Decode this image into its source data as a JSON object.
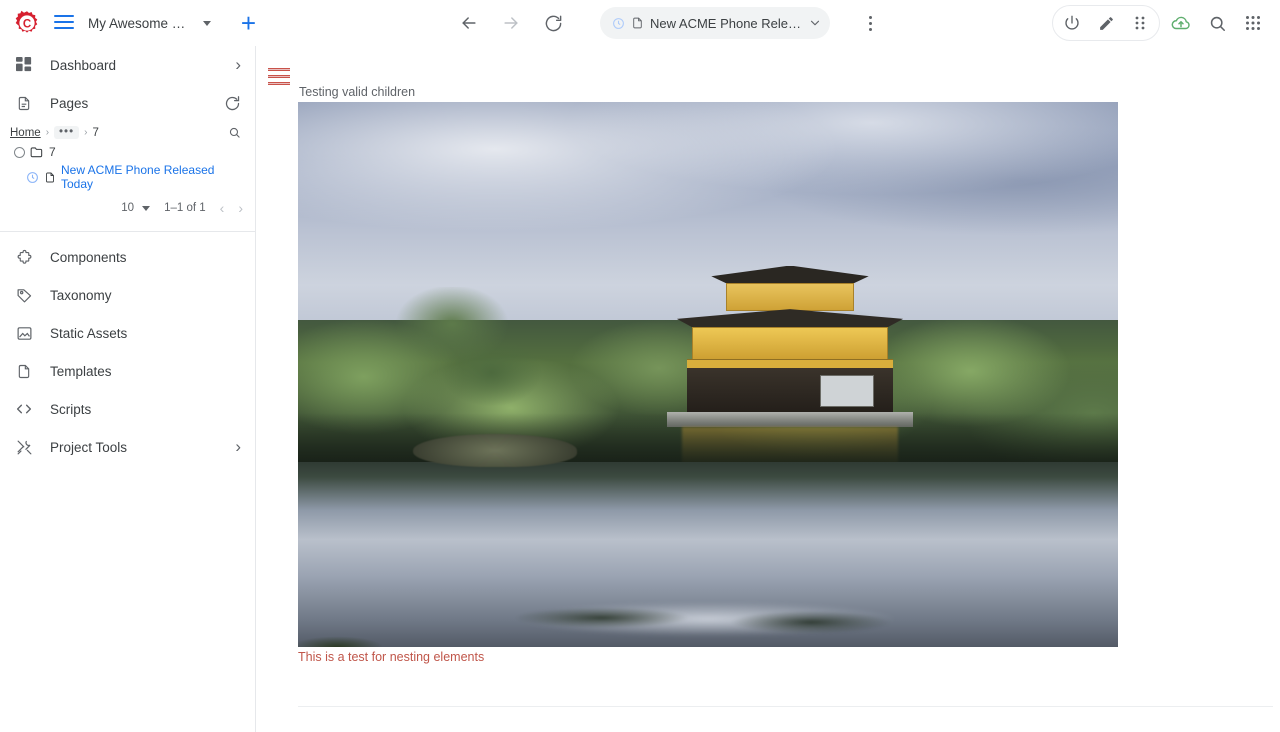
{
  "browser": {
    "back_label": "Back",
    "forward_label": "Forward",
    "reload_label": "Reload",
    "tab_title": "New ACME Phone Released ...",
    "menu_label": "More options",
    "dropdown_label": "Open dropdown"
  },
  "app": {
    "project_name": "My Awesome E...",
    "logo_letter": "C",
    "add_label": "+"
  },
  "toolbar_right": {
    "items": [
      {
        "name": "power-icon",
        "label": "Power"
      },
      {
        "name": "edit-pencil-icon",
        "label": "Edit"
      },
      {
        "name": "drag-dots-icon",
        "label": "Drag"
      },
      {
        "name": "cloud-upload-icon",
        "label": "Publish",
        "color": "#34a853"
      },
      {
        "name": "search-icon",
        "label": "Search"
      },
      {
        "name": "apps-grid-icon",
        "label": "Apps"
      }
    ]
  },
  "sidebar": {
    "dashboard": {
      "label": "Dashboard",
      "icon": "dashboard-icon",
      "chevron": "›"
    },
    "pages": {
      "label": "Pages",
      "icon": "page-icon",
      "refresh": "refresh-icon"
    },
    "breadcrumb": {
      "home": "Home",
      "sep1": "›",
      "ellipsis": "•••",
      "sep2": "›",
      "current": "7"
    },
    "tree": [
      {
        "label": "7",
        "type": "folder",
        "selected": false
      },
      {
        "label": "New ACME Phone Released Today",
        "type": "page",
        "selected": true
      }
    ],
    "pagination": {
      "page_size": "10",
      "range": "1–1 of 1",
      "prev": "‹",
      "next": "›"
    },
    "items": [
      {
        "label": "Components",
        "icon": "puzzle-icon",
        "chevron": ""
      },
      {
        "label": "Taxonomy",
        "icon": "tag-icon",
        "chevron": ""
      },
      {
        "label": "Static Assets",
        "icon": "image-icon",
        "chevron": ""
      },
      {
        "label": "Templates",
        "icon": "file-icon",
        "chevron": ""
      },
      {
        "label": "Scripts",
        "icon": "code-icon",
        "chevron": ""
      },
      {
        "label": "Project Tools",
        "icon": "tools-icon",
        "chevron": "›"
      }
    ]
  },
  "content": {
    "menu_label": "Component menu",
    "title": "Testing valid children",
    "image_alt": "Golden Pavilion temple reflected in a pond",
    "caption": "This is a test for nesting elements",
    "caption_color": "#c0564a"
  }
}
